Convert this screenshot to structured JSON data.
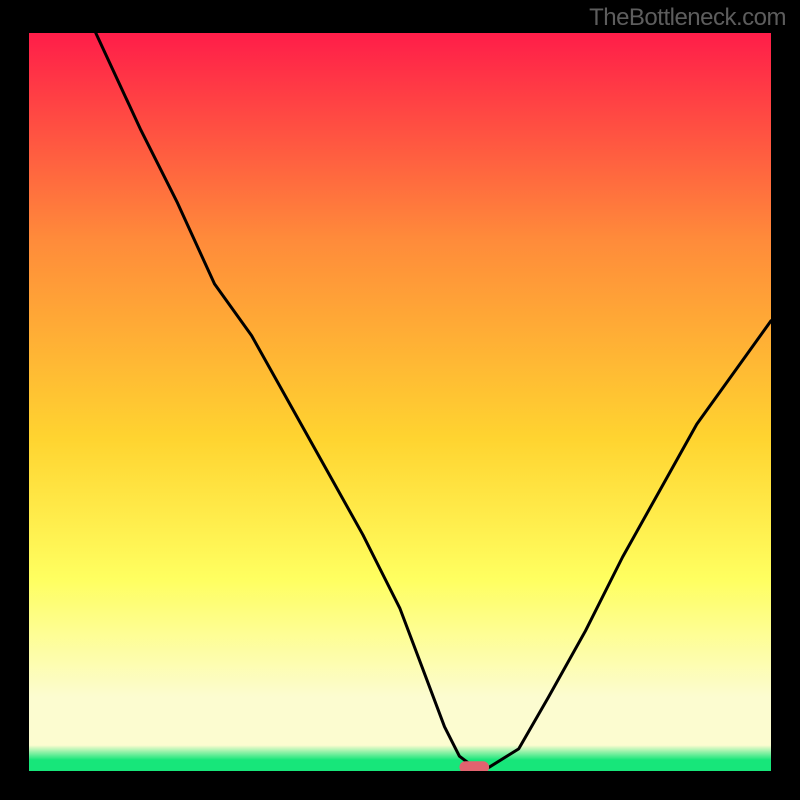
{
  "watermark": "TheBottleneck.com",
  "colors": {
    "frame_bg": "#000000",
    "plot_bg_gradient": {
      "top": "#ff1d49",
      "upper_mid": "#ff8b3a",
      "mid": "#ffd430",
      "lower_mid": "#ffff60",
      "pale": "#fcfcd0",
      "green": "#17e67a"
    },
    "curve": "#000000",
    "marker": "#e2636f"
  },
  "chart_data": {
    "type": "line",
    "title": "",
    "xlabel": "",
    "ylabel": "",
    "xlim": [
      0,
      100
    ],
    "ylim": [
      0,
      100
    ],
    "series": [
      {
        "name": "bottleneck-curve",
        "x": [
          9,
          15,
          20,
          25,
          30,
          35,
          40,
          45,
          50,
          53,
          56,
          58,
          60,
          62,
          66,
          70,
          75,
          80,
          85,
          90,
          95,
          100
        ],
        "y": [
          100,
          87,
          77,
          66,
          59,
          50,
          41,
          32,
          22,
          14,
          6,
          2,
          0.5,
          0.5,
          3,
          10,
          19,
          29,
          38,
          47,
          54,
          61
        ]
      }
    ],
    "marker": {
      "name": "optimal-range",
      "x_start": 58,
      "x_end": 62,
      "y": 0.5
    }
  }
}
